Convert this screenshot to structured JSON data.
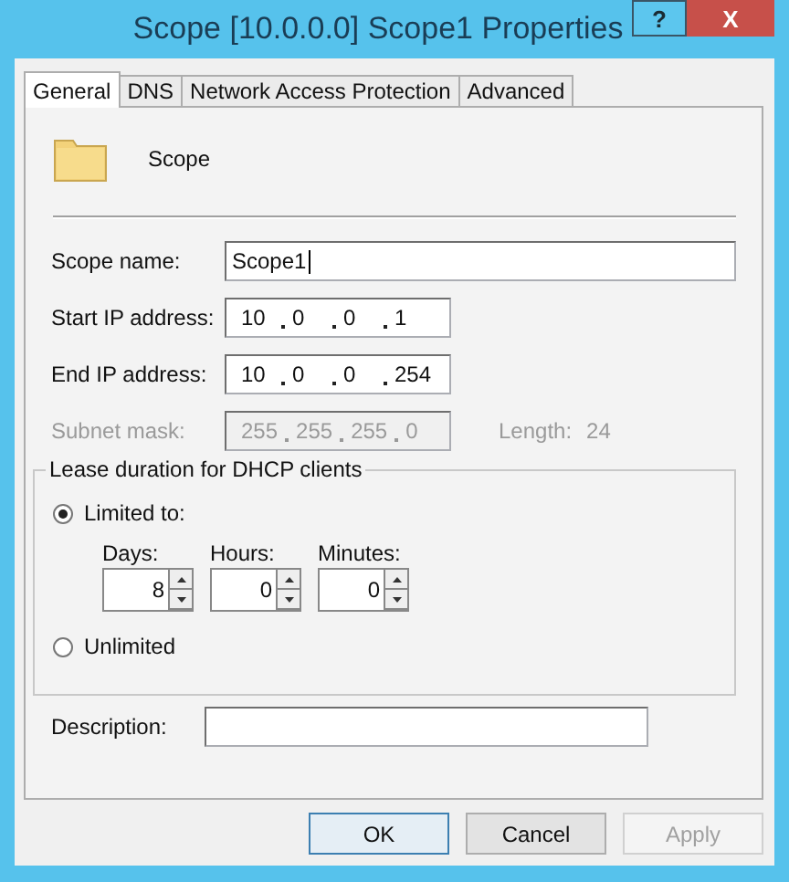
{
  "window": {
    "title": "Scope [10.0.0.0] Scope1 Properties",
    "help_glyph": "?",
    "close_glyph": "X"
  },
  "tabs": [
    {
      "label": "General",
      "selected": true
    },
    {
      "label": "DNS",
      "selected": false
    },
    {
      "label": "Network Access Protection",
      "selected": false
    },
    {
      "label": "Advanced",
      "selected": false
    }
  ],
  "header": {
    "label": "Scope"
  },
  "fields": [
    {
      "kind": "text",
      "label": "Scope name:",
      "value": "Scope1",
      "disabled": false
    },
    {
      "kind": "ip",
      "label": "Start IP address:",
      "octets": [
        "10",
        "0",
        "0",
        "1"
      ],
      "disabled": false
    },
    {
      "kind": "ip",
      "label": "End IP address:",
      "octets": [
        "10",
        "0",
        "0",
        "254"
      ],
      "disabled": false
    },
    {
      "kind": "ip",
      "label": "Subnet mask:",
      "octets": [
        "255",
        "255",
        "255",
        "0"
      ],
      "disabled": true,
      "length_label": "Length:",
      "length_value": "24"
    }
  ],
  "lease": {
    "title": "Lease duration for DHCP clients",
    "options": [
      {
        "label": "Limited to:",
        "selected": true
      },
      {
        "label": "Unlimited",
        "selected": false
      }
    ],
    "spinners": [
      {
        "label": "Days:",
        "value": "8"
      },
      {
        "label": "Hours:",
        "value": "0"
      },
      {
        "label": "Minutes:",
        "value": "0"
      }
    ]
  },
  "description": {
    "label": "Description:"
  },
  "buttons": [
    {
      "label": "OK",
      "default": true,
      "disabled": false
    },
    {
      "label": "Cancel",
      "default": false,
      "disabled": false
    },
    {
      "label": "Apply",
      "default": false,
      "disabled": true
    }
  ]
}
